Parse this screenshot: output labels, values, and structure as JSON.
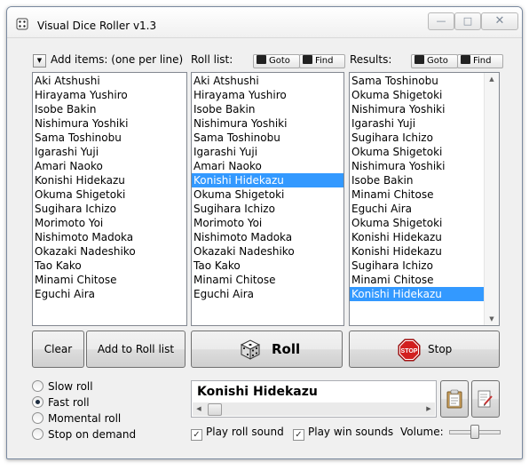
{
  "window": {
    "title": "Visual Dice Roller v1.3"
  },
  "add_items": {
    "label": "Add items: (one per line)",
    "items": [
      "Aki Atshushi",
      "Hirayama Yushiro",
      "Isobe Bakin",
      "Nishimura Yoshiki",
      "Sama Toshinobu",
      "Igarashi Yuji",
      "Amari Naoko",
      "Konishi Hidekazu",
      "Okuma Shigetoki",
      "Sugihara Ichizo",
      "Morimoto Yoi",
      "Nishimoto Madoka",
      "Okazaki Nadeshiko",
      "Tao Kako",
      "Minami Chitose",
      "Eguchi Aira"
    ]
  },
  "roll_list": {
    "label": "Roll list:",
    "goto_label": "Goto",
    "find_label": "Find",
    "items": [
      "Aki Atshushi",
      "Hirayama Yushiro",
      "Isobe Bakin",
      "Nishimura Yoshiki",
      "Sama Toshinobu",
      "Igarashi Yuji",
      "Amari Naoko",
      "Konishi Hidekazu",
      "Okuma Shigetoki",
      "Sugihara Ichizo",
      "Morimoto Yoi",
      "Nishimoto Madoka",
      "Okazaki Nadeshiko",
      "Tao Kako",
      "Minami Chitose",
      "Eguchi Aira"
    ],
    "selected_index": 7
  },
  "results": {
    "label": "Results:",
    "goto_label": "Goto",
    "find_label": "Find",
    "items": [
      "Sama Toshinobu",
      "Okuma Shigetoki",
      "Nishimura Yoshiki",
      "Igarashi Yuji",
      "Sugihara Ichizo",
      "Okuma Shigetoki",
      "Nishimura Yoshiki",
      "Isobe Bakin",
      "Minami Chitose",
      "Eguchi Aira",
      "Okuma Shigetoki",
      "Konishi Hidekazu",
      "Konishi Hidekazu",
      "Sugihara Ichizo",
      "Minami Chitose",
      "Konishi Hidekazu"
    ],
    "selected_index": 15
  },
  "buttons": {
    "clear": "Clear",
    "add_to_roll": "Add to Roll list",
    "roll": "Roll",
    "stop": "Stop",
    "stop_icon_text": "STOP"
  },
  "roll_modes": [
    {
      "label": "Slow roll",
      "checked": false
    },
    {
      "label": "Fast roll",
      "checked": true
    },
    {
      "label": "Momental roll",
      "checked": false
    },
    {
      "label": "Stop on demand",
      "checked": false
    }
  ],
  "current_result": "Konishi Hidekazu",
  "options": {
    "play_roll_sound": {
      "label": "Play roll sound",
      "checked": true
    },
    "play_win_sounds": {
      "label": "Play win sounds",
      "checked": true
    },
    "volume_label": "Volume:",
    "volume_level": 0.5
  },
  "colors": {
    "selection": "#3399ff",
    "stop_red": "#d21f1f",
    "window_bg": "#f0f0f0"
  }
}
